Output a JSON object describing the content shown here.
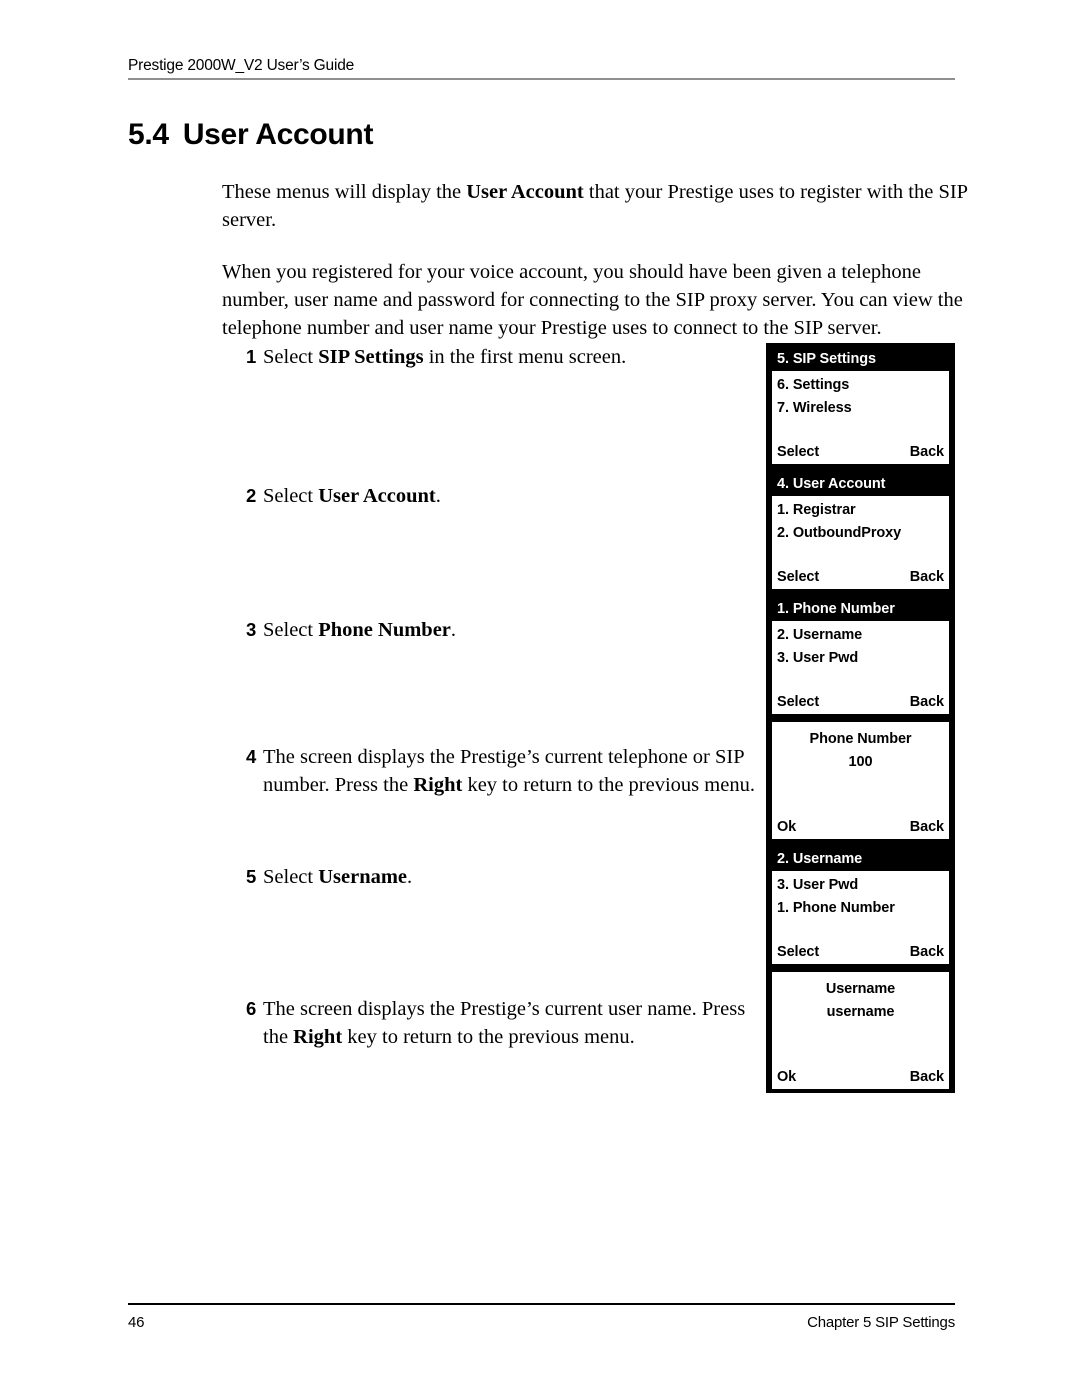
{
  "header": {
    "running_title": "Prestige 2000W_V2 User’s Guide"
  },
  "section": {
    "number": "5.4",
    "title": "User Account"
  },
  "paragraphs": [
    {
      "before": "These menus will display the ",
      "bold": "User Account",
      "after": " that your Prestige uses to register with the SIP server."
    },
    {
      "before": "When you registered for your voice account, you should have been given a telephone number, user name and password for connecting to the SIP proxy server. You can view the telephone number and user name your Prestige uses to connect to the SIP server.",
      "bold": "",
      "after": ""
    }
  ],
  "steps": [
    {
      "num": "1",
      "before": "Select ",
      "bold": "SIP Settings",
      "after": " in the first menu screen."
    },
    {
      "num": "2",
      "before": "Select ",
      "bold": "User Account",
      "after": "."
    },
    {
      "num": "3",
      "before": "Select ",
      "bold": "Phone Number",
      "after": "."
    },
    {
      "num": "4",
      "before": "The screen displays the Prestige’s current telephone or SIP number. Press the ",
      "bold": "Right",
      "after": " key to return to the previous menu."
    },
    {
      "num": "5",
      "before": "Select ",
      "bold": "Username",
      "after": "."
    },
    {
      "num": "6",
      "before": "The screen displays the Prestige’s current user name. Press the ",
      "bold": "Right",
      "after": " key to return to the previous menu."
    }
  ],
  "lcd_screens": [
    {
      "id": "sip-settings",
      "title": "5. SIP Settings",
      "has_title_bar": true,
      "rows": [
        "6. Settings",
        "7. Wireless"
      ],
      "softkey_left": "Select",
      "softkey_right": "Back"
    },
    {
      "id": "user-account",
      "title": "4. User Account",
      "has_title_bar": true,
      "rows": [
        "1. Registrar",
        "2. OutboundProxy"
      ],
      "softkey_left": "Select",
      "softkey_right": "Back"
    },
    {
      "id": "phone-number-menu",
      "title": "1. Phone Number",
      "has_title_bar": true,
      "rows": [
        "2. Username",
        "3. User Pwd"
      ],
      "softkey_left": "Select",
      "softkey_right": "Back"
    },
    {
      "id": "phone-number-value",
      "title": "",
      "has_title_bar": false,
      "rows": [
        "Phone Number",
        "100"
      ],
      "softkey_left": "Ok",
      "softkey_right": "Back"
    },
    {
      "id": "username-menu",
      "title": "2. Username",
      "has_title_bar": true,
      "rows": [
        "3. User Pwd",
        "1. Phone Number"
      ],
      "softkey_left": "Select",
      "softkey_right": "Back"
    },
    {
      "id": "username-value",
      "title": "",
      "has_title_bar": false,
      "rows": [
        "Username",
        "username"
      ],
      "softkey_left": "Ok",
      "softkey_right": "Back"
    }
  ],
  "footer": {
    "page_number": "46",
    "chapter": "Chapter 5 SIP Settings"
  },
  "colors": {
    "text": "#000000",
    "page_background": "#ffffff",
    "header_rule": "#8f8f8f",
    "lcd_frame": "#000000",
    "lcd_screen": "#ffffff",
    "lcd_title_text": "#ffffff"
  }
}
